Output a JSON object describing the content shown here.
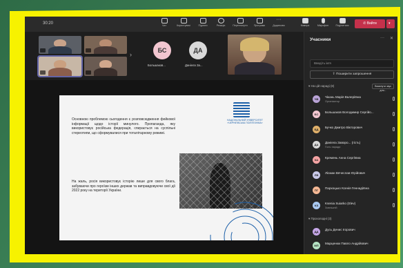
{
  "toolbar": {
    "time": "30:20",
    "buttons": [
      {
        "label": "Чат",
        "icon": "chat-icon"
      },
      {
        "label": "Користувачі",
        "icon": "people-icon"
      },
      {
        "label": "Підняти",
        "icon": "raise-hand-icon"
      },
      {
        "label": "Реакція",
        "icon": "reaction-icon"
      },
      {
        "label": "Переглянути",
        "icon": "view-icon"
      },
      {
        "label": "Програми",
        "icon": "apps-icon"
      },
      {
        "label": "Додатково",
        "icon": "more-icon"
      },
      {
        "label": "Камера",
        "icon": "camera-icon"
      },
      {
        "label": "Мікрофон",
        "icon": "mic-icon"
      },
      {
        "label": "Поділитися",
        "icon": "share-icon"
      }
    ],
    "leave_label": "Вийти"
  },
  "strip": {
    "avatars": [
      {
        "initials": "БС",
        "name": "Большаков...",
        "color": "#f2c6d0"
      },
      {
        "initials": "ДА",
        "name": "Даніела За...",
        "color": "#d9d9d9"
      }
    ]
  },
  "slide": {
    "paragraph1": "Основною проблемою сьогодення є розповсюдження фейкової інформації щодо історії минулого. Пропаганда, яку використовує російська федерація, спирається на суспільні стереотипи, що сформувалися при тоталітарному режимі.",
    "paragraph2": "На жаль, росія використовує історію лише для свого блага, забуваючи про героїзм інших держав та виправдовуючи свої дії 2022 року на території України.",
    "logo_text": "НАЦІОНАЛЬНИЙ УНІВЕРСИТЕТ «ЧЕРНІГІВСЬКА ПОЛІТЕХНІКА»"
  },
  "panel": {
    "title": "Учасники",
    "search_placeholder": "Введіть ім'я",
    "share_invite": "Поширити запрошення",
    "in_meeting": "На цій нараді (8)",
    "mute_all": "Вимкнути звук для...",
    "participants": [
      {
        "initials": "ЧВ",
        "name": "Чікань Марія Валеріївна",
        "sub": "Організатор",
        "color": "#b9a3d6"
      },
      {
        "initials": "БС",
        "name": "Большаков Володимир Сергійо...",
        "sub": "",
        "color": "#f2c6d0"
      },
      {
        "initials": "БД",
        "name": "Бучко Дмитро Вікторович",
        "sub": "",
        "color": "#e0b06a"
      },
      {
        "initials": "ДА",
        "name": "Даніела Заворо... (гість)",
        "sub": "Гість наради",
        "color": "#d9d9d9"
      },
      {
        "initials": "КА",
        "name": "Кремень Анна Сергіївна",
        "sub": "",
        "color": "#f4a3a3"
      },
      {
        "initials": "ЛВ",
        "name": "Лісман Вячеслав Юрійович",
        "sub": "",
        "color": "#c9c9e8"
      },
      {
        "initials": "ПГ",
        "name": "Пархоцько Ксенія Геннадіївна",
        "sub": "",
        "color": "#f5b894"
      },
      {
        "initials": "KS",
        "name": "Ksenia Suiarko (Elev)",
        "sub": "Зовнішній",
        "color": "#a9c8f0"
      }
    ],
    "invited": "Прохолодні (3)",
    "invited_list": [
      {
        "initials": "ДД",
        "name": "Дусь Денис Ігорович",
        "color": "#c6a7e8"
      },
      {
        "initials": "МП",
        "name": "Марценюк Павло Андрійович",
        "color": "#b5e3c3"
      }
    ]
  }
}
